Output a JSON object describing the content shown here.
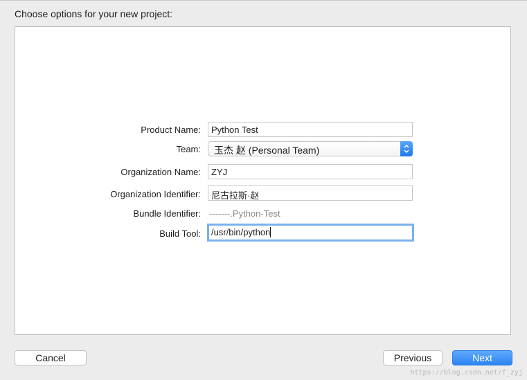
{
  "header": {
    "title": "Choose options for your new project:"
  },
  "form": {
    "product_name": {
      "label": "Product Name:",
      "value": "Python Test"
    },
    "team": {
      "label": "Team:",
      "value": "玉杰 赵 (Personal Team)",
      "arrow_icon": "up-down-chevron-icon"
    },
    "organization_name": {
      "label": "Organization Name:",
      "value": "ZYJ"
    },
    "organization_identifier": {
      "label": "Organization Identifier:",
      "value": "尼古拉斯·赵"
    },
    "bundle_identifier": {
      "label": "Bundle Identifier:",
      "value": "-------.Python-Test"
    },
    "build_tool": {
      "label": "Build Tool:",
      "value": "/usr/bin/python"
    }
  },
  "footer": {
    "cancel_label": "Cancel",
    "previous_label": "Previous",
    "next_label": "Next"
  },
  "watermark": "https://blog.csdn.net/f_zyj",
  "colors": {
    "accent": "#2c84f2",
    "focus_ring": "#7bb1ee"
  }
}
